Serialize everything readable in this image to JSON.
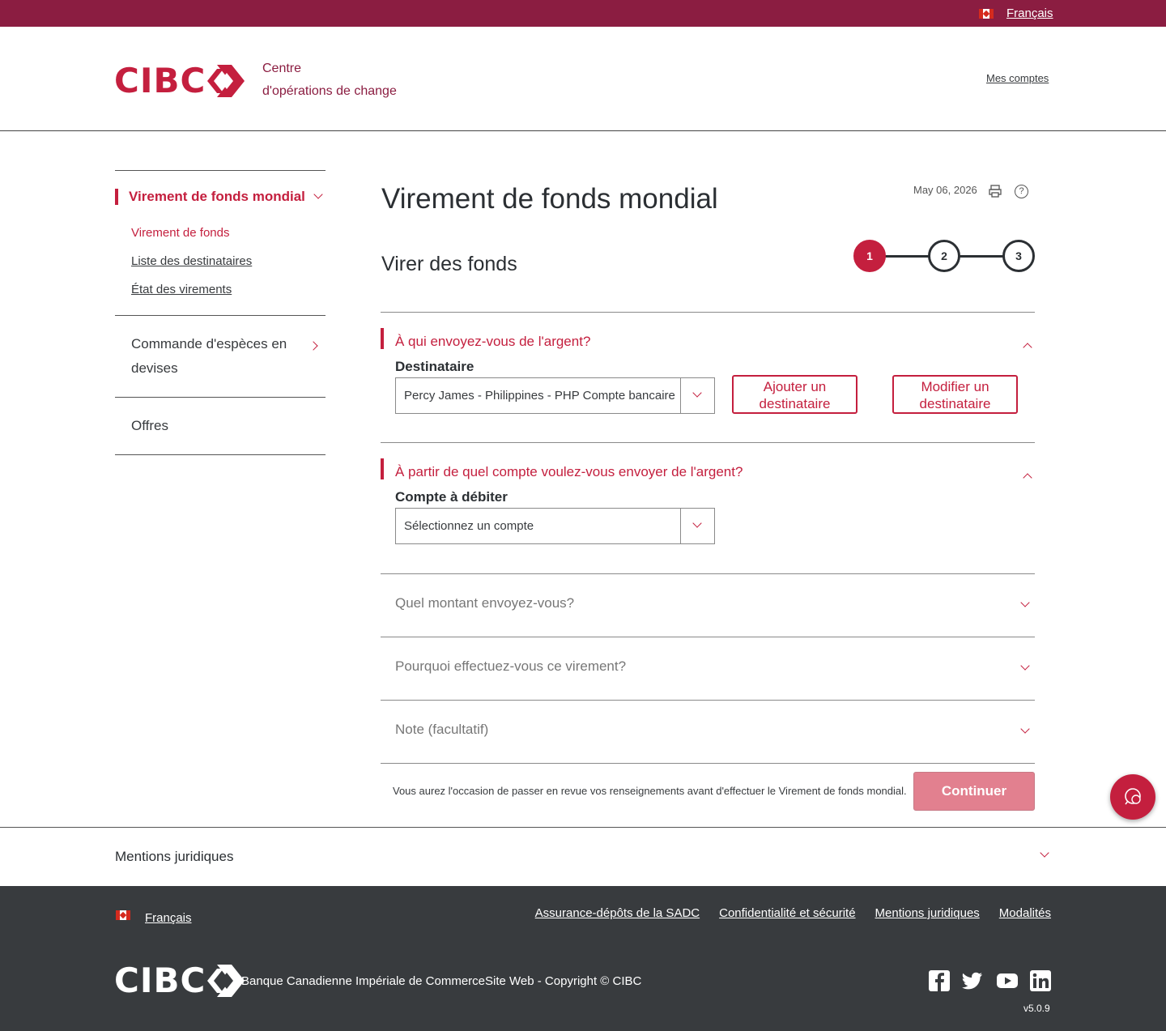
{
  "topbar": {
    "language": "Français"
  },
  "header": {
    "logo": "CIBC",
    "centre_line1": "Centre",
    "centre_line2": "d'opérations de change",
    "my_accounts": "Mes comptes"
  },
  "sidebar": {
    "main": "Virement de fonds mondial",
    "sub_items": [
      "Virement de fonds",
      "Liste des destinataires",
      "État des virements"
    ],
    "cash_order_line1": "Commande d'espèces en",
    "cash_order_line2": "devises",
    "offers": "Offres"
  },
  "main": {
    "title": "Virement de fonds mondial",
    "date": "May 06, 2026",
    "subtitle": "Virer des fonds",
    "steps": [
      "1",
      "2",
      "3"
    ],
    "current_step": 1,
    "section1": {
      "title": "À qui envoyez-vous de l'argent?",
      "label": "Destinataire",
      "value": "Percy James - Philippines - PHP Compte bancaire",
      "add_line1": "Ajouter un",
      "add_line2": "destinataire",
      "edit_line1": "Modifier un",
      "edit_line2": "destinataire"
    },
    "section2": {
      "title": "À partir de quel compte voulez-vous envoyer de l'argent?",
      "label": "Compte à débiter",
      "placeholder": "Sélectionnez un compte"
    },
    "section3": {
      "title": "Quel montant envoyez-vous?"
    },
    "section4": {
      "title": "Pourquoi effectuez-vous ce virement?"
    },
    "section5": {
      "title": "Note (facultatif)"
    },
    "review_note": "Vous aurez l'occasion de passer en revue vos renseignements avant d'effectuer le Virement de fonds mondial.",
    "continue": "Continuer"
  },
  "legal": {
    "title": "Mentions juridiques"
  },
  "footer": {
    "language": "Français",
    "links": [
      "Assurance-dépôts de la SADC",
      "Confidentialité et sécurité",
      "Mentions juridiques",
      "Modalités"
    ],
    "logo": "CIBC",
    "copyright": "Banque Canadienne Impériale de CommerceSite Web - Copyright © CIBC",
    "social": [
      "facebook-icon",
      "twitter-icon",
      "youtube-icon",
      "linkedin-icon"
    ],
    "version": "v5.0.9"
  },
  "colors": {
    "brand": "#8b1d41",
    "accent": "#c41f3e",
    "footer_bg": "#383b3e",
    "continue_disabled": "#e2808f"
  }
}
